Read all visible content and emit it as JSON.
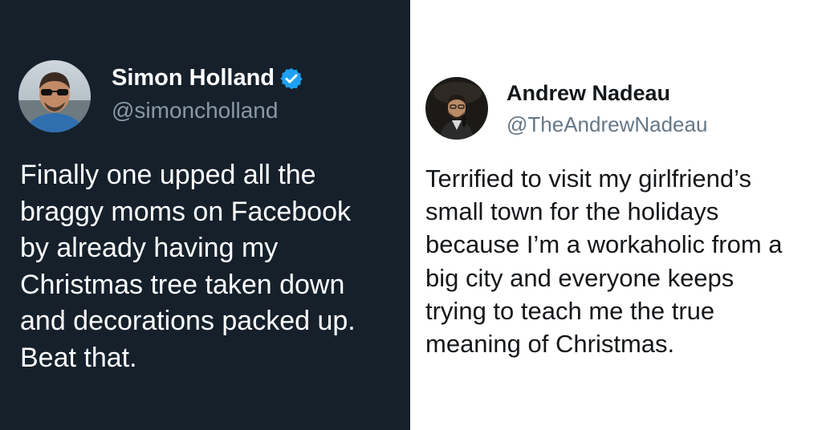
{
  "left_tweet": {
    "display_name": "Simon Holland",
    "handle": "@simoncholland",
    "verified": true,
    "text": "Finally one upped all the\nbraggy moms on Facebook\nby already having my\nChristmas tree taken down\nand decorations packed up.\nBeat that.",
    "background_color": "#15202b",
    "accent_color": "#1da1f2"
  },
  "right_tweet": {
    "display_name": "Andrew Nadeau",
    "handle": "@TheAndrewNadeau",
    "verified": false,
    "text": "Terrified to visit my girlfriend’s\nsmall town for the holidays\nbecause I’m a workaholic from a\nbig city and everyone keeps\ntrying to teach me the true\nmeaning of Christmas.",
    "background_color": "#ffffff"
  },
  "icons": {
    "verified_badge": "verified-badge-icon"
  }
}
